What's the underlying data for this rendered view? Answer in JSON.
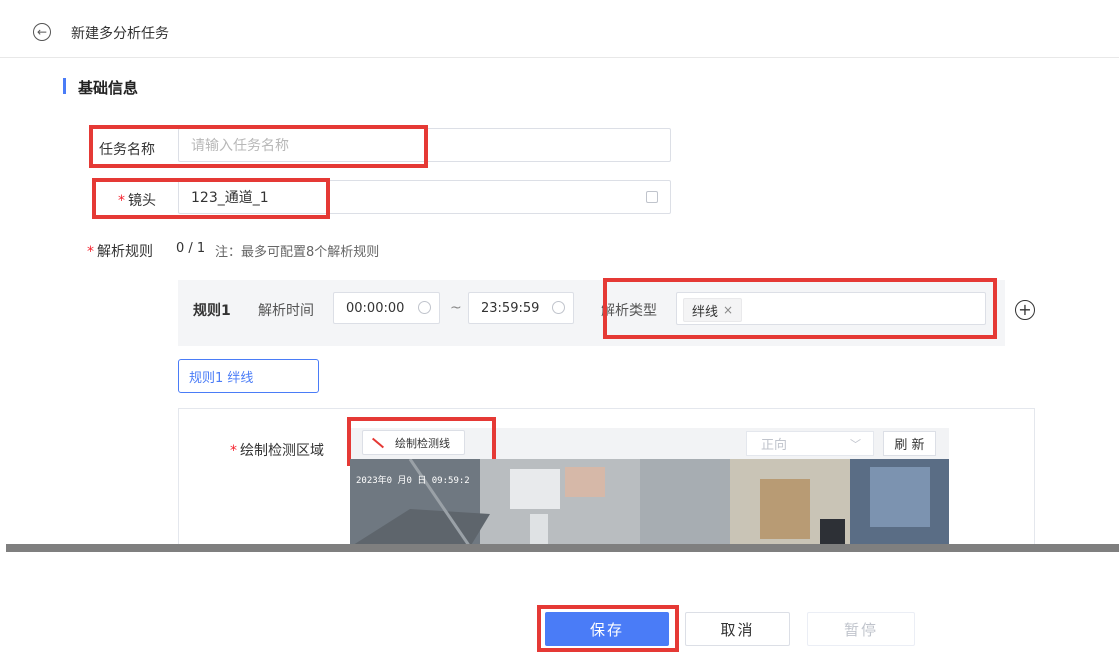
{
  "header": {
    "back_icon": "back-arrow-icon",
    "title": "新建多分析任务"
  },
  "section": {
    "title": "基础信息"
  },
  "form": {
    "task_name": {
      "label": "任务名称",
      "placeholder": "请输入任务名称",
      "value": ""
    },
    "camera": {
      "required_mark": "*",
      "label": "镜头",
      "value": "123_通道_1",
      "icon": "select-camera-icon"
    },
    "rules": {
      "required_mark": "*",
      "label": "解析规则",
      "count": "0 / 1",
      "note": "注：最多可配置8个解析规则"
    }
  },
  "rule_row": {
    "name": "规则1",
    "time_label": "解析时间",
    "start_time": "00:00:00",
    "separator": "~",
    "end_time": "23:59:59",
    "type_label": "解析类型",
    "type_tag": "绊线",
    "tag_close": "×",
    "add_icon": "plus-circle-icon"
  },
  "rule_tab": {
    "label": "规则1 绊线"
  },
  "draw": {
    "required_mark": "*",
    "label": "绘制检测区域",
    "draw_button": "绘制检测线",
    "direction_value": "正向",
    "refresh_button": "刷 新",
    "video_timestamp": "2023年0 月0 日 09:59:2"
  },
  "footer": {
    "save": "保存",
    "cancel": "取消",
    "pause": "暂停"
  },
  "colors": {
    "accent": "#4a7cf7",
    "highlight": "#e53935",
    "required": "#f5222d"
  }
}
